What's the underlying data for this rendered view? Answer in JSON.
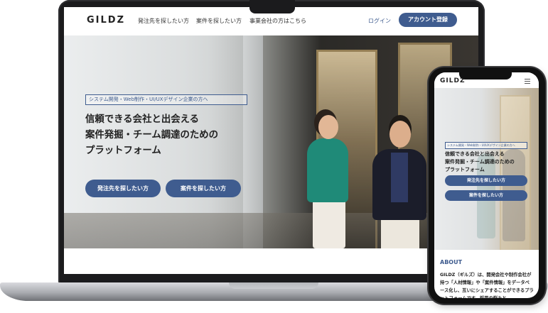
{
  "laptop": {
    "header": {
      "logo": "GILDZ",
      "nav": [
        "発注先を探したい方",
        "案件を探したい方",
        "事業会社の方はこちら"
      ],
      "login": "ログイン",
      "signup": "アカウント登録"
    },
    "hero": {
      "tag": "システム開発・Web制作・UI/UXデザイン企業の方へ",
      "headline": [
        "信頼できる会社と出会える",
        "案件発掘・チーム調達のための",
        "プラットフォーム"
      ],
      "buttons": [
        "発注先を探したい方",
        "案件を探したい方"
      ]
    }
  },
  "phone": {
    "header": {
      "logo": "GILDZ",
      "menu_icon": "hamburger-menu-icon"
    },
    "hero": {
      "tag": "システム開発・Web制作・UI/UXデザイン企業の方へ",
      "headline": [
        "信頼できる会社と出会える",
        "案件発掘・チーム調達のための",
        "プラットフォーム"
      ],
      "buttons": [
        "発注先を探したい方",
        "案件を探したい方"
      ]
    },
    "about": {
      "title": "ABOUT",
      "text": "GILDZ（ギルズ）は、開発会社や制作会社が持つ「人材情報」や「案件情報」をデータベース化し、互いにシェアすることができるプラットフォームです。採用の悩みと"
    }
  },
  "colors": {
    "accent": "#3f5c8f",
    "device_frame": "#1b1b1d",
    "laptop_base": "#a9abb0"
  }
}
